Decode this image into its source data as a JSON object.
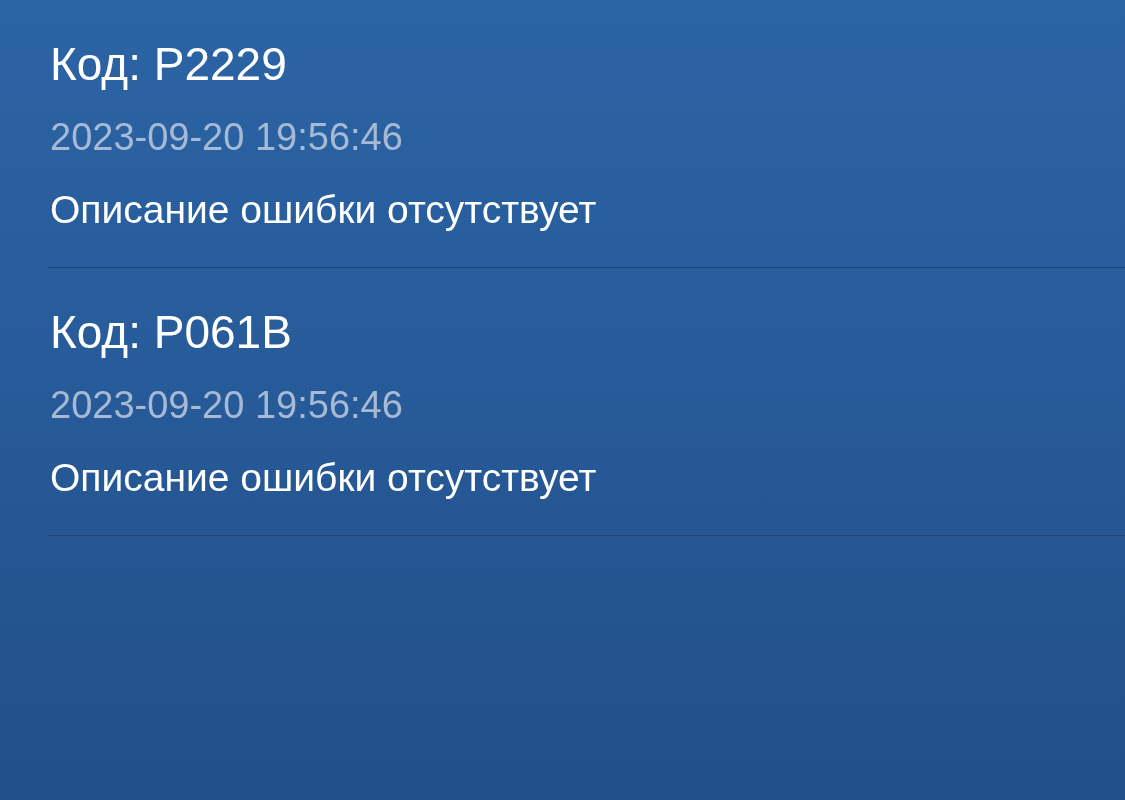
{
  "errors": [
    {
      "code": "Код: P2229",
      "time": "2023-09-20 19:56:46",
      "description": "Описание ошибки отсутствует"
    },
    {
      "code": "Код: P061B",
      "time": "2023-09-20 19:56:46",
      "description": "Описание ошибки отсутствует"
    }
  ]
}
